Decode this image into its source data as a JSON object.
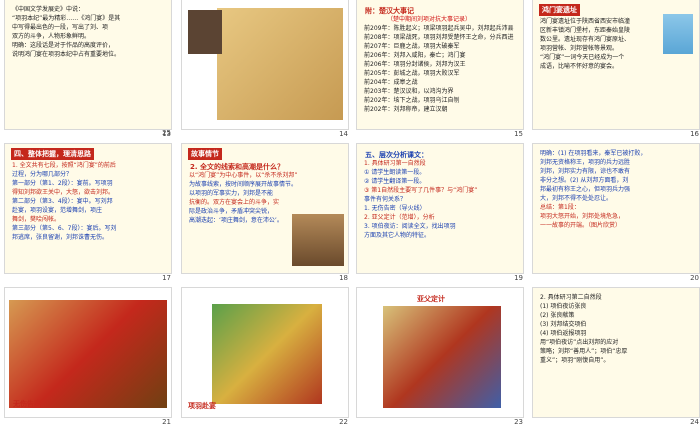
{
  "slides": [
    {
      "num": "13",
      "lines": [
        "鸿门宴不久，项羽即统兵以解前城，",
        "之命，封刘邦为汉王，改封关中之",
        "地，分封诸王。楚汉之际，项",
        "羽迎战于垓下，大败，自刎于乌江。",
        "前202年10月到汉王，项羽彭城",
        "作战失利，面对汉军，被迫自杀。"
      ]
    },
    {
      "num": "14"
    },
    {
      "num": "15",
      "title": "附：楚汉大事记",
      "subtitle": "（楚中期间刘项对抗大事记录）",
      "lines": [
        "前209年：陈胜起义；项梁项羽起兵吴中，刘邦起兵沛县",
        "前208年：项梁战死，项羽刘邦受楚怀王之命，分兵西进",
        "前207年：巨鹿之战，项羽大破秦军",
        "前206年：刘邦入咸阳，秦亡；鸿门宴",
        "前206年：项羽分封诸侯，刘邦为汉王",
        "前205年：彭城之战，项羽大败汉军",
        "前204年：成皋之战",
        "前203年：楚汉议和，以鸿沟为界",
        "前202年：垓下之战，项羽乌江自刎",
        "前202年：刘邦称帝，建立汉朝"
      ]
    },
    {
      "num": "16",
      "tag": "鸿门宴遗址",
      "lines": [
        "鸿门宴遗址位于陕西省西安市临潼",
        "区新丰镇鸿门堡村，东距秦始皇陵",
        "数公里。遗址现存有鸿门宴原址、",
        "项羽营帐、刘邦营帐等景观。",
        "“鸿门宴”一词今天已经成为一个",
        "成语，比喻不怀好意的宴会。"
      ]
    },
    {
      "num": "17",
      "tag": "四、整体把握，理清思路",
      "lines": [
        "1. 全文共有七段，按照“鸿门宴”的前后",
        "过程，分为哪几部分？",
        "第一部分（第1、2段）：宴前。写项羽",
        "得知刘邦欲王关中，大怒，欲击刘邦。",
        "第二部分（第3、4段）：宴中。写刘邦",
        "赴宴，项羽设宴，范增舞剑，项庄",
        "舞剑，樊哙闯帐。",
        "第三部分（第5、6、7段）：宴后。写刘",
        "邦逃席，张良留谢，刘邦诛曹无伤。"
      ]
    },
    {
      "num": "18",
      "tag": "故事情节",
      "title": "2. 全文的线索和高潮是什么？",
      "lines": [
        "以“鸿门宴”为中心事件，以“杀不杀刘邦”",
        "为故事线索，按时间顺序展开故事情节。",
        "以项羽的军事实力，刘邦是不能",
        "抗衡的。双方在宴会上的斗争，实",
        "际是政治斗争，矛盾冲突尖锐，",
        "高潮迭起：‘项庄舞剑，意在沛公’。"
      ]
    },
    {
      "num": "19",
      "title": "五、层次分析课文：",
      "lines": [
        "1. 具体研习第一自然段",
        "  ① 请学生朗读第一段。",
        "  ② 请学生翻译第一段。",
        "  ③ 第1自然段主要写了几件事？与“鸿门宴”",
        "     事件有何关系？",
        "1. 无伤告密（导火线）",
        "2. 亚父定计（范增），分析",
        "3. 项伯夜访：阅读全文，找出项羽",
        "   方面及其它人物的特征。"
      ]
    },
    {
      "num": "20",
      "lines": [
        "明确：(1) 在项羽看来，秦军已被打败，",
        "刘邦无资格称王，项羽的兵力远胜",
        "刘邦，刘邦实力有限，谅也不敢有",
        "非分之想。(2) 从刘邦方面看，刘",
        "邦最初有称王之心，但项羽兵力强",
        "大，刘邦不得不处处忍让。",
        "总结：第1段：",
        "项羽大怒开始，刘邦处境危急，",
        "一一故事的开端。（图片欣赏）"
      ]
    },
    {
      "num": "21",
      "caption": "无伤告密"
    },
    {
      "num": "22",
      "caption": "项羽赴宴"
    },
    {
      "num": "23",
      "caption": "亚父定计"
    },
    {
      "num": "24",
      "lines": [
        "2. 具体研习第二自然段",
        "  (1) 项伯夜访张良",
        "  (2) 张良献策",
        "  (3) 刘邦结交项伯",
        "  (4) 项伯返报项羽",
        "  用“项伯夜访”点出刘邦的应对",
        "  策略；刘邦“善用人”；项伯“忠厚",
        "  重义”；项羽“刚愎自用”。"
      ]
    },
    {
      "num": "25",
      "lines": [
        "《中国文学发展史》中说：",
        "“项羽本纪”最为精彩……《鸿门宴》是其",
        "中写得最出色的一段，写出了刘、项",
        "双方的斗争，人物形象鲜明。",
        "明确：这段话是对于作品的高度评价，",
        "说明鸿门宴在项羽本纪中占有重要地位。"
      ]
    }
  ]
}
